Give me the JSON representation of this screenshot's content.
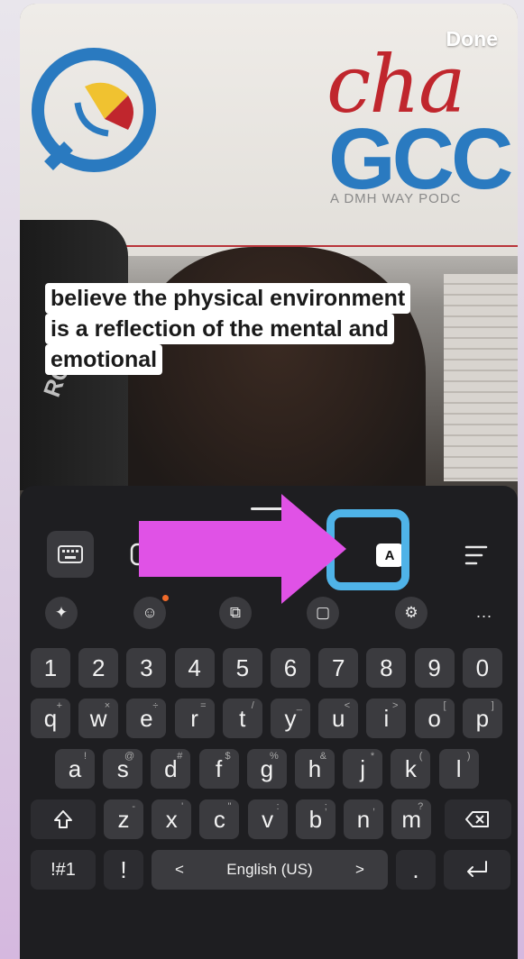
{
  "top": {
    "done_label": "Done"
  },
  "video": {
    "brand_script": "cha",
    "brand_letters": "GCC",
    "brand_sub": "A DMH WAY PODC",
    "mic_brand": "RODE"
  },
  "caption": {
    "lines": [
      "believe the physical environment",
      "is a reflection of the mental and",
      "emotional"
    ]
  },
  "toolbar": {
    "keyboard_icon": "keyboard-icon",
    "text_style_icon": "text-style-icon",
    "font_box_label": "A",
    "align_icon": "align-icon"
  },
  "keyboard": {
    "row2_icons": [
      "ai-sparkle-icon",
      "emoji-icon",
      "translate-icon",
      "clipboard-icon",
      "settings-icon"
    ],
    "more_label": "...",
    "numbers": [
      "1",
      "2",
      "3",
      "4",
      "5",
      "6",
      "7",
      "8",
      "9",
      "0"
    ],
    "row_q": [
      "q",
      "w",
      "e",
      "r",
      "t",
      "y",
      "u",
      "i",
      "o",
      "p"
    ],
    "row_q_sup": [
      "+",
      "×",
      "÷",
      "=",
      "/",
      "_",
      "<",
      ">",
      "[",
      "]"
    ],
    "row_a": [
      "a",
      "s",
      "d",
      "f",
      "g",
      "h",
      "j",
      "k",
      "l"
    ],
    "row_a_sup": [
      "!",
      "@",
      "#",
      "$",
      "%",
      "&",
      "*",
      "(",
      ")"
    ],
    "row_z": [
      "z",
      "x",
      "c",
      "v",
      "b",
      "n",
      "m"
    ],
    "row_z_sup": [
      "-",
      "'",
      "\"",
      ":",
      ";",
      ",",
      "?"
    ],
    "symbols_label": "!#1",
    "exclaim_label": "!",
    "space_label": "English (US)",
    "space_left": "<",
    "space_right": ">",
    "period_label": "."
  },
  "colors": {
    "highlight": "#4fb3e8",
    "arrow": "#e052e6",
    "panel": "#1e1e21",
    "key": "#3b3b3f"
  }
}
